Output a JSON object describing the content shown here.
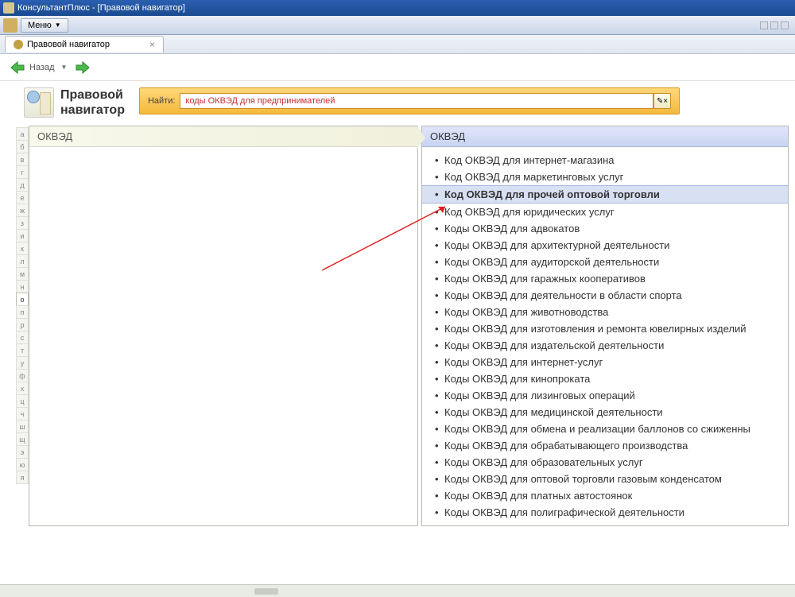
{
  "window": {
    "title": "КонсультантПлюс - [Правовой навигатор]"
  },
  "menu": {
    "label": "Меню"
  },
  "tab": {
    "label": "Правовой навигатор"
  },
  "nav": {
    "back": "Назад"
  },
  "page": {
    "title_line1": "Правовой",
    "title_line2": "навигатор"
  },
  "search": {
    "label": "Найти:",
    "value": "коды ОКВЭД для предпринимателей"
  },
  "left": {
    "header": "ОКВЭД"
  },
  "right": {
    "header": "ОКВЭД",
    "selected_index": 2,
    "items": [
      "Код ОКВЭД для интернет-магазина",
      "Код ОКВЭД для маркетинговых услуг",
      "Код ОКВЭД для прочей оптовой торговли",
      "Код ОКВЭД для юридических услуг",
      "Коды ОКВЭД для адвокатов",
      "Коды ОКВЭД для архитектурной деятельности",
      "Коды ОКВЭД для аудиторской деятельности",
      "Коды ОКВЭД для гаражных кооперативов",
      "Коды ОКВЭД для деятельности в области спорта",
      "Коды ОКВЭД для животноводства",
      "Коды ОКВЭД для изготовления и ремонта ювелирных изделий",
      "Коды ОКВЭД для издательской деятельности",
      "Коды ОКВЭД для интернет-услуг",
      "Коды ОКВЭД для кинопроката",
      "Коды ОКВЭД для лизинговых операций",
      "Коды ОКВЭД для медицинской деятельности",
      "Коды ОКВЭД для обмена и реализации баллонов со сжиженны",
      "Коды ОКВЭД для обрабатывающего производства",
      "Коды ОКВЭД для образовательных услуг",
      "Коды ОКВЭД для оптовой торговли газовым конденсатом",
      "Коды ОКВЭД для платных автостоянок",
      "Коды ОКВЭД для полиграфической деятельности"
    ]
  },
  "alpha": [
    "а",
    "б",
    "в",
    "г",
    "д",
    "е",
    "ж",
    "з",
    "и",
    "к",
    "л",
    "м",
    "н",
    "о",
    "п",
    "р",
    "с",
    "т",
    "у",
    "ф",
    "х",
    "ц",
    "ч",
    "ш",
    "щ",
    "э",
    "ю",
    "я"
  ],
  "alpha_active_index": 13
}
